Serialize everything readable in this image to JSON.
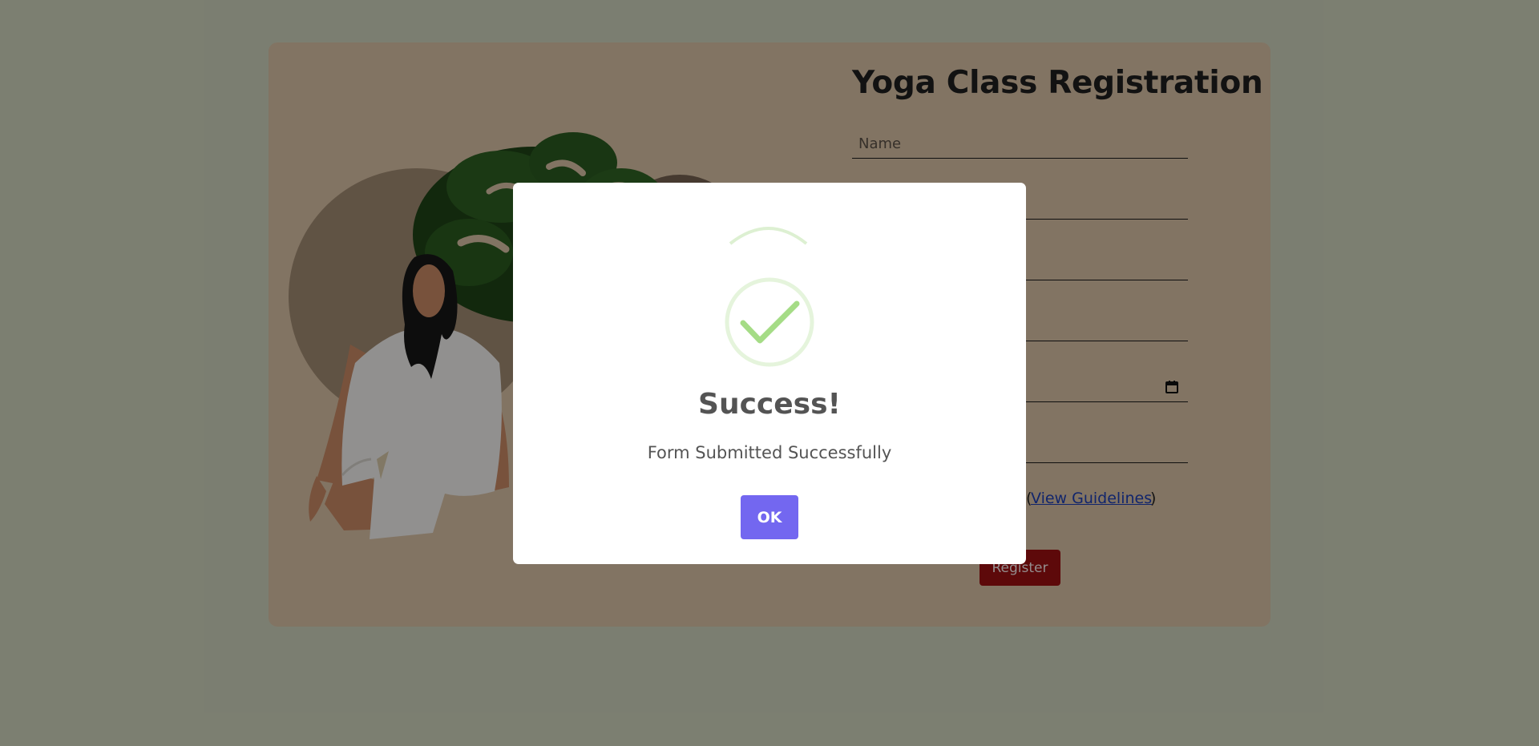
{
  "page": {
    "background_color": "#ced3bd",
    "card_color": "#d9c1a5"
  },
  "form": {
    "title": "Yoga Class Registration",
    "name_placeholder": "Name",
    "guidelines_prefix": "(",
    "guidelines_link": "View Guidelines",
    "guidelines_suffix": ")",
    "register_label": "Register",
    "register_color": "#9b0f12"
  },
  "modal": {
    "title": "Success!",
    "message": "Form Submitted Successfully",
    "ok_label": "OK",
    "ok_color": "#7367f0",
    "icon": "success-check-icon"
  }
}
